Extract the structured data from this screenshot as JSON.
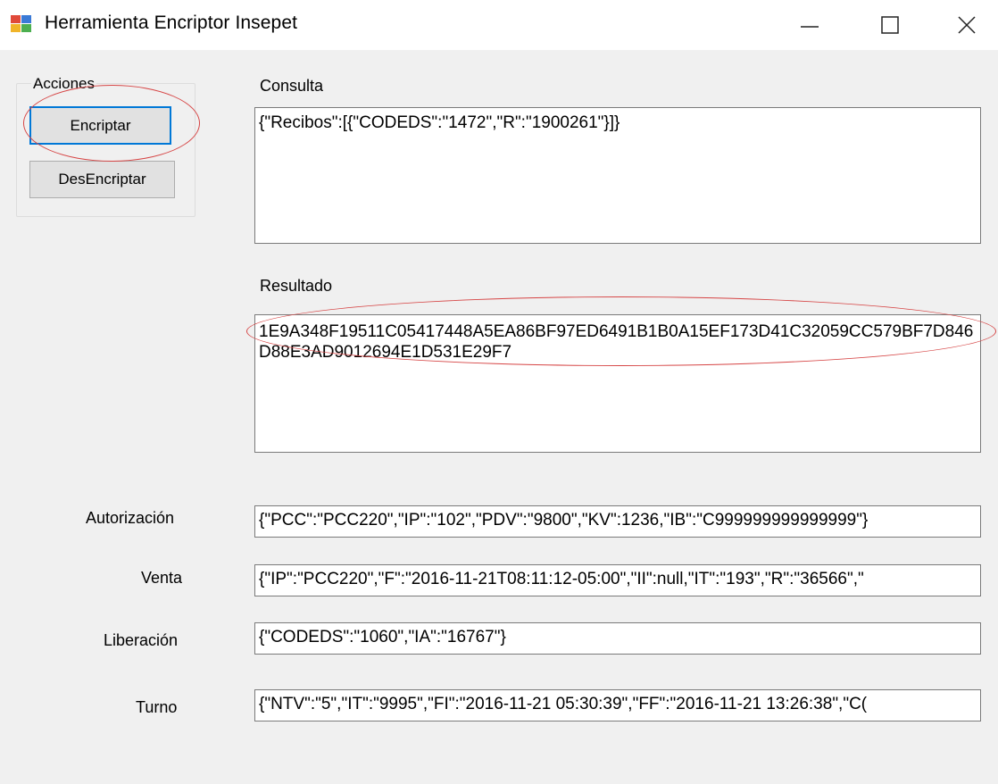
{
  "window": {
    "title": "Herramienta Encriptor Insepet",
    "min_glyph": "—",
    "max_glyph": "☐",
    "close_glyph": "✕"
  },
  "acciones": {
    "group_label": "Acciones",
    "encrypt_label": "Encriptar",
    "decrypt_label": "DesEncriptar"
  },
  "consulta": {
    "label": "Consulta",
    "value": "{\"Recibos\":[{\"CODEDS\":\"1472\",\"R\":\"1900261\"}]}"
  },
  "resultado": {
    "label": "Resultado",
    "value": "1E9A348F19511C05417448A5EA86BF97ED6491B1B0A15EF173D41C32059CC579BF7D846D88E3AD9012694E1D531E29F7"
  },
  "fields": [
    {
      "label": "Autorización",
      "value": "{\"PCC\":\"PCC220\",\"IP\":\"102\",\"PDV\":\"9800\",\"KV\":1236,\"IB\":\"C999999999999999\"}"
    },
    {
      "label": "Venta",
      "value": "{\"IP\":\"PCC220\",\"F\":\"2016-11-21T08:11:12-05:00\",\"II\":null,\"IT\":\"193\",\"R\":\"36566\",\""
    },
    {
      "label": "Liberación",
      "value": "{\"CODEDS\":\"1060\",\"IA\":\"16767\"}"
    },
    {
      "label": "Turno",
      "value": "{\"NTV\":\"5\",\"IT\":\"9995\",\"FI\":\"2016-11-21 05:30:39\",\"FF\":\"2016-11-21 13:26:38\",\"C("
    }
  ],
  "colors": {
    "highlight_ellipse": "#d64545",
    "focus_border": "#0078d7"
  },
  "icons": {
    "app": "app-window-icon"
  }
}
